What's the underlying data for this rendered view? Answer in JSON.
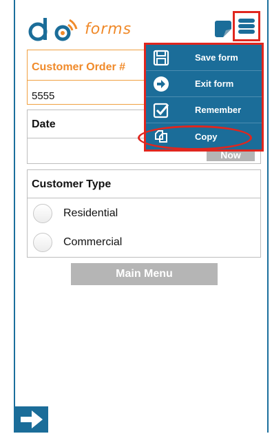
{
  "brand": {
    "logo_text": "forms",
    "logo_letters": "do"
  },
  "form": {
    "order": {
      "label": "Customer Order #",
      "value": "5555"
    },
    "date": {
      "label": "Date",
      "now_label": "Now"
    },
    "customer_type": {
      "label": "Customer Type",
      "options": [
        "Residential",
        "Commercial"
      ]
    },
    "main_menu_label": "Main Menu"
  },
  "menu": {
    "items": [
      {
        "label": "Save form",
        "icon": "save-icon"
      },
      {
        "label": "Exit form",
        "icon": "exit-arrow-icon"
      },
      {
        "label": "Remember",
        "icon": "checkbox-icon"
      },
      {
        "label": "Copy",
        "icon": "copy-icon"
      }
    ]
  },
  "colors": {
    "brand_orange": "#f08a2a",
    "brand_blue": "#1b6d99",
    "highlight_red": "#e0261e",
    "button_gray": "#b5b5b5"
  }
}
